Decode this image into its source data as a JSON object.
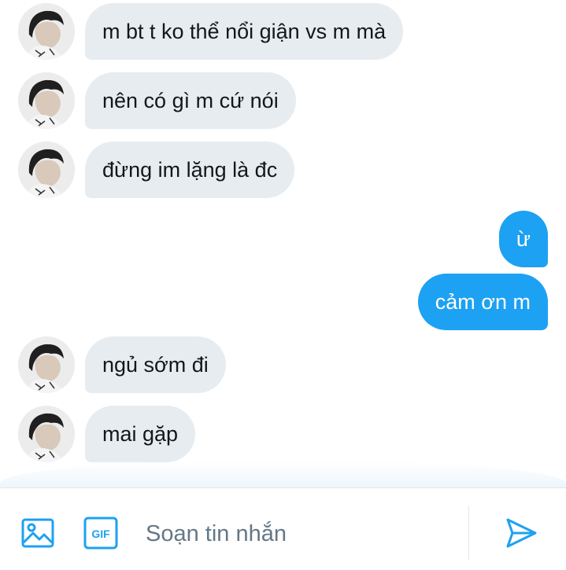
{
  "messages": [
    {
      "side": "in",
      "text": "m bt t ko thể nổi giận vs m mà"
    },
    {
      "side": "in",
      "text": "nên có gì m cứ nói"
    },
    {
      "side": "in",
      "text": "đừng im lặng là đc"
    },
    {
      "side": "out",
      "text": "ừ"
    },
    {
      "side": "out",
      "text": "cảm ơn m"
    },
    {
      "side": "in",
      "text": "ngủ sớm đi"
    },
    {
      "side": "in",
      "text": "mai gặp"
    }
  ],
  "composer": {
    "placeholder": "Soạn tin nhắn",
    "gif_label": "GIF",
    "icons": [
      "image-icon",
      "gif-icon",
      "send-icon"
    ]
  },
  "colors": {
    "accent": "#1da1f2",
    "incoming_bubble": "#e6ecf0",
    "placeholder_text": "#657786"
  }
}
